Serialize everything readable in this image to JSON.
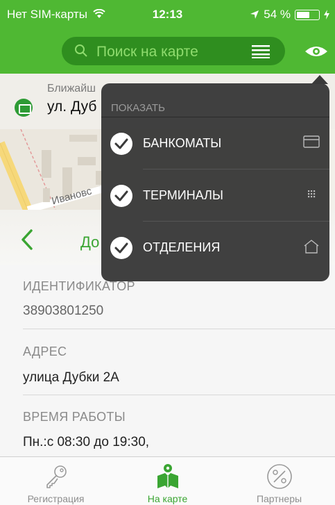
{
  "status": {
    "carrier": "Нет SIM-карты",
    "time": "12:13",
    "battery": "54 %"
  },
  "search": {
    "placeholder": "Поиск на карте"
  },
  "map": {
    "nearest_label": "Ближайш",
    "street": "ул. Дуб",
    "street_label": "Ивановс"
  },
  "back": {
    "title": "До"
  },
  "popover": {
    "header": "ПОКАЗАТЬ",
    "items": [
      {
        "label": "БАНКОМАТЫ",
        "icon": "card-icon",
        "checked": true
      },
      {
        "label": "ТЕРМИНАЛЫ",
        "icon": "grid-dots-icon",
        "checked": true
      },
      {
        "label": "ОТДЕЛЕНИЯ",
        "icon": "house-icon",
        "checked": true
      }
    ]
  },
  "details": {
    "id_label": "ИДЕНТИФИКАТОР",
    "id_value": "38903801250",
    "address_label": "АДРЕС",
    "address_value": "улица Дубки 2А",
    "hours_label": "ВРЕМЯ РАБОТЫ",
    "hours_value": "Пн.:с 08:30 до 19:30,"
  },
  "tabs": [
    {
      "label": "Регистрация",
      "icon": "key-icon",
      "active": false
    },
    {
      "label": "На карте",
      "icon": "map-person-icon",
      "active": true
    },
    {
      "label": "Партнеры",
      "icon": "percent-icon",
      "active": false
    }
  ],
  "colors": {
    "brand": "#4fb833",
    "brand_dark": "#2f8e1f",
    "accent_text": "#3aa532",
    "popover_bg": "#3a3a3a"
  }
}
